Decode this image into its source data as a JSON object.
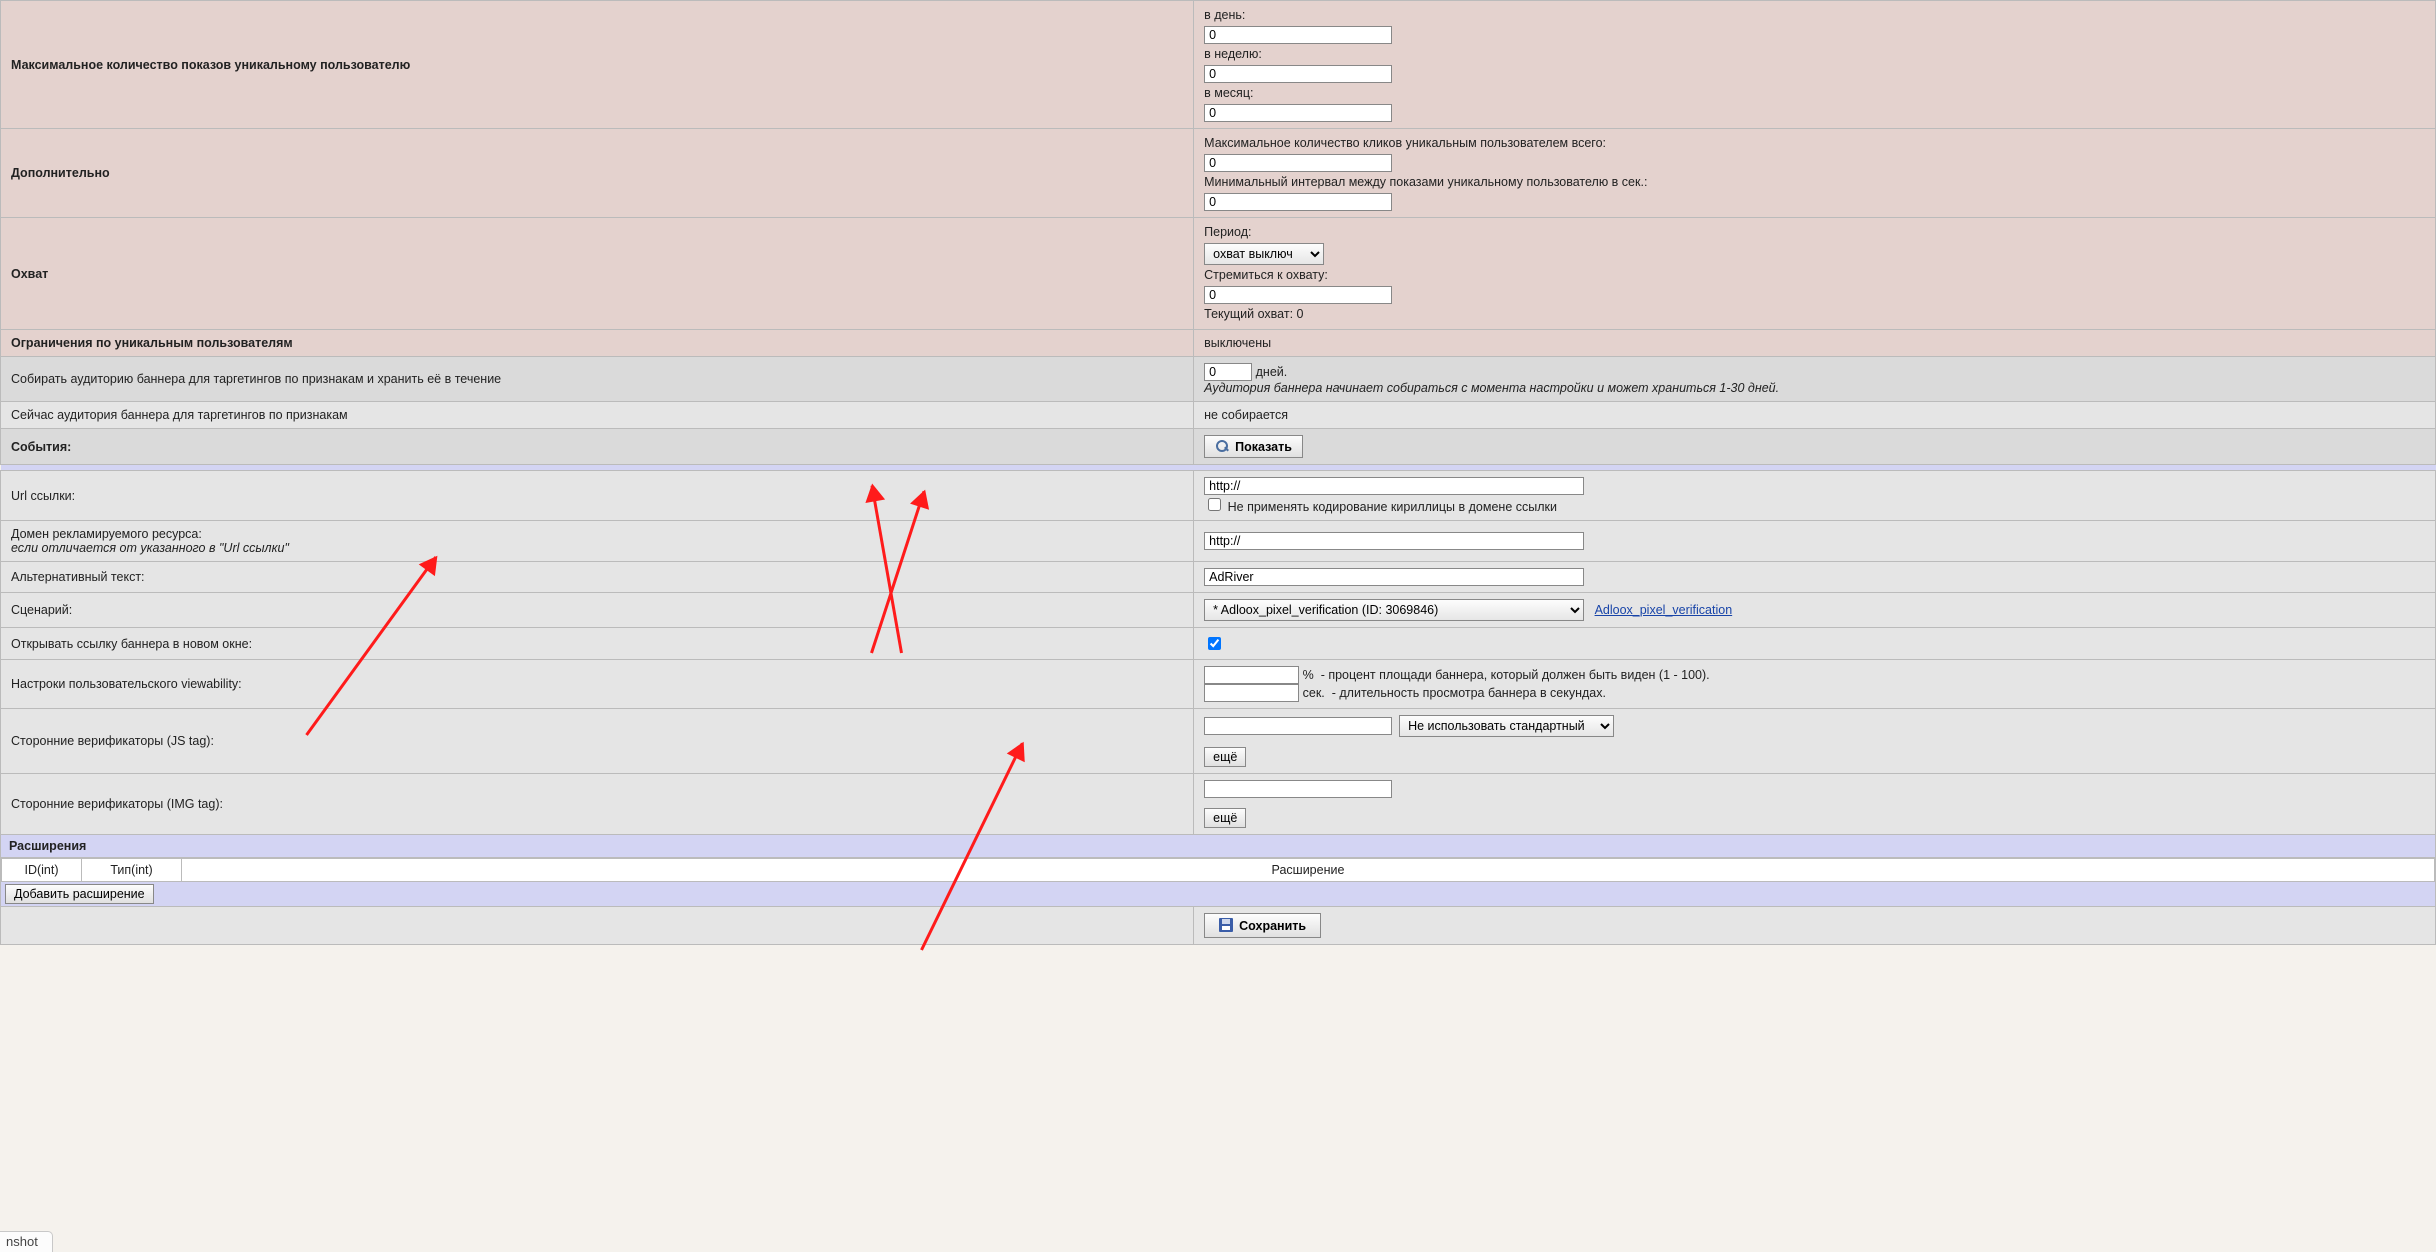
{
  "rows": {
    "maxImpressions": {
      "label": "Максимальное количество показов уникальному пользователю",
      "perDay": {
        "label": "в день:",
        "value": "0"
      },
      "perWeek": {
        "label": "в неделю:",
        "value": "0"
      },
      "perMonth": {
        "label": "в месяц:",
        "value": "0"
      }
    },
    "additional": {
      "label": "Дополнительно",
      "maxClicks": {
        "label": "Максимальное количество кликов уникальным пользователем всего:",
        "value": "0"
      },
      "minInterval": {
        "label": "Минимальный интервал между показами уникальному пользователю в сек.:",
        "value": "0"
      }
    },
    "reach": {
      "label": "Охват",
      "periodLabel": "Период:",
      "periodValue": "охват выключ",
      "aspireLabel": "Стремиться к охвату:",
      "aspireValue": "0",
      "currentReach": "Текущий охват: 0"
    },
    "uniqueRestrictions": {
      "label": "Ограничения по уникальным пользователям",
      "value": "выключены"
    },
    "collectAudience": {
      "label": "Собирать аудиторию баннера для таргетингов по признакам и хранить её в течение",
      "daysValue": "0",
      "daysUnit": "дней.",
      "note": "Аудитория баннера начинает собираться с момента настройки и может храниться 1-30 дней."
    },
    "currentAudience": {
      "label": "Сейчас аудитория баннера для таргетингов по признакам",
      "value": "не собирается"
    },
    "events": {
      "label": "События:",
      "buttonLabel": "Показать"
    },
    "urlLink": {
      "label": "Url ссылки:",
      "value": "http://",
      "checkboxLabel": "Не применять кодирование кириллицы в домене ссылки"
    },
    "domain": {
      "label": "Домен рекламируемого ресурса:",
      "sub": "если отличается от указанного в \"Url ссылки\"",
      "value": "http://"
    },
    "altText": {
      "label": "Альтернативный текст:",
      "value": "AdRiver"
    },
    "scenario": {
      "label": "Сценарий:",
      "selected": "* Adloox_pixel_verification (ID: 3069846)",
      "link": "Adloox_pixel_verification"
    },
    "openNewWindow": {
      "label": "Открывать ссылку баннера в новом окне:",
      "checked": true
    },
    "viewability": {
      "label": "Настроки пользовательского viewability:",
      "areaValue": "",
      "areaUnit": "%",
      "areaHint": "- процент площади баннера, который должен быть виден (1 - 100).",
      "secValue": "",
      "secUnit": "сек.",
      "secHint": "- длительность просмотра баннера в секундах."
    },
    "verifiersJS": {
      "label": "Сторонние верификаторы (JS tag):",
      "value": "",
      "selectValue": "Не использовать стандартный",
      "moreLabel": "ещё"
    },
    "verifiersIMG": {
      "label": "Сторонние верификаторы (IMG tag):",
      "value": "",
      "moreLabel": "ещё"
    }
  },
  "extensions": {
    "title": "Расширения",
    "colId": "ID(int)",
    "colType": "Тип(int)",
    "colExt": "Расширение",
    "addBtn": "Добавить расширение"
  },
  "footer": {
    "saveLabel": "Сохранить"
  },
  "tag": "nshot"
}
